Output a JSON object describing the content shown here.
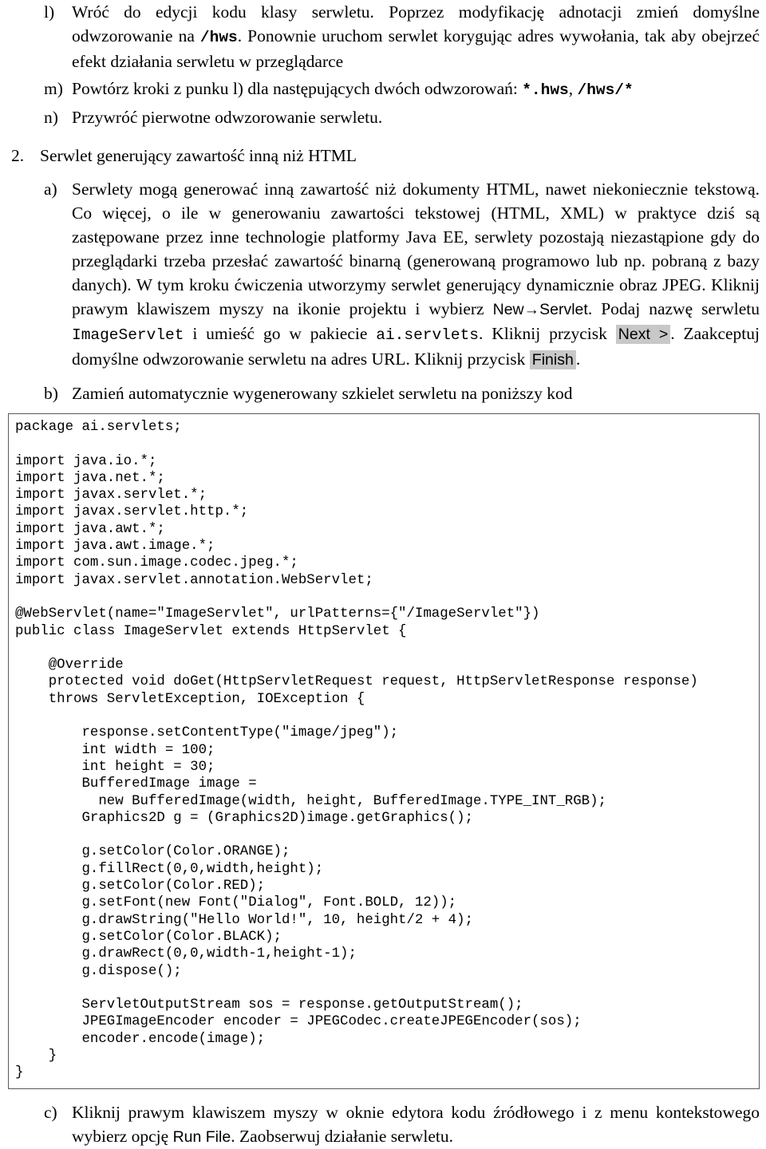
{
  "document": {
    "type": "exercise-handout",
    "language": "pl"
  },
  "items": [
    {
      "id": "l",
      "level": "alpha",
      "marker": "l)",
      "runs": [
        {
          "style": "normal",
          "text": "Wróć do edycji kodu klasy serwletu. Poprzez modyfikację adnotacji zmień domyślne odwzorowanie na "
        },
        {
          "style": "mono-bold",
          "text": "/hws"
        },
        {
          "style": "normal",
          "text": ". Ponownie uruchom serwlet korygując adres wywołania, tak aby obejrzeć efekt działania serwletu w przeglądarce"
        }
      ]
    },
    {
      "id": "m",
      "level": "alpha",
      "marker": "m)",
      "runs": [
        {
          "style": "normal",
          "text": "Powtórz kroki z punku l) dla następujących dwóch odwzorowań: "
        },
        {
          "style": "mono-bold",
          "text": "*.hws"
        },
        {
          "style": "normal",
          "text": ", "
        },
        {
          "style": "mono-bold",
          "text": "/hws/*"
        }
      ]
    },
    {
      "id": "n",
      "level": "alpha",
      "marker": "n)",
      "runs": [
        {
          "style": "normal",
          "text": "Przywróć pierwotne odwzorowanie serwletu."
        }
      ]
    },
    {
      "id": "2",
      "level": "num",
      "marker": "2.",
      "runs": [
        {
          "style": "normal",
          "text": "Serwlet generujący zawartość inną niż HTML"
        }
      ]
    },
    {
      "id": "2a",
      "level": "alpha",
      "marker": "a)",
      "runs": [
        {
          "style": "normal",
          "text": "Serwlety mogą generować inną zawartość niż dokumenty HTML, nawet niekoniecznie tekstową. Co więcej, o ile w generowaniu zawartości tekstowej (HTML, XML) w praktyce dziś są zastępowane przez inne technologie platformy Java EE, serwlety pozostają niezastąpione gdy do przeglądarki trzeba przesłać zawartość binarną (generowaną programowo lub np. pobraną z bazy danych). W tym kroku ćwiczenia utworzymy serwlet generujący dynamicznie obraz JPEG. Kliknij prawym klawiszem myszy na ikonie projektu i wybierz "
        },
        {
          "style": "ui",
          "text": "New→Servlet"
        },
        {
          "style": "normal",
          "text": ". Podaj nazwę serwletu "
        },
        {
          "style": "mono",
          "text": "ImageServlet"
        },
        {
          "style": "normal",
          "text": " i umieść go w pakiecie "
        },
        {
          "style": "mono",
          "text": "ai.servlets"
        },
        {
          "style": "normal",
          "text": ". Kliknij przycisk "
        },
        {
          "style": "ui-button",
          "text": "Next >"
        },
        {
          "style": "normal",
          "text": ". Zaakceptuj domyślne odwzorowanie serwletu na adres URL. Kliknij przycisk "
        },
        {
          "style": "ui-button",
          "text": "Finish"
        },
        {
          "style": "normal",
          "text": "."
        }
      ]
    },
    {
      "id": "2b",
      "level": "alpha",
      "marker": "b)",
      "justify": false,
      "runs": [
        {
          "style": "normal",
          "text": "Zamień automatycznie wygenerowany szkielet serwletu na poniższy kod"
        }
      ]
    }
  ],
  "code_block": {
    "language": "java",
    "border_color": "#595959",
    "text": "package ai.servlets;\n\nimport java.io.*;\nimport java.net.*;\nimport javax.servlet.*;\nimport javax.servlet.http.*;\nimport java.awt.*;\nimport java.awt.image.*;\nimport com.sun.image.codec.jpeg.*;\nimport javax.servlet.annotation.WebServlet;\n\n@WebServlet(name=\"ImageServlet\", urlPatterns={\"/ImageServlet\"})\npublic class ImageServlet extends HttpServlet {\n\n    @Override\n    protected void doGet(HttpServletRequest request, HttpServletResponse response)\n    throws ServletException, IOException {\n\n        response.setContentType(\"image/jpeg\");\n        int width = 100;\n        int height = 30;\n        BufferedImage image =\n          new BufferedImage(width, height, BufferedImage.TYPE_INT_RGB);\n        Graphics2D g = (Graphics2D)image.getGraphics();\n\n        g.setColor(Color.ORANGE);\n        g.fillRect(0,0,width,height);\n        g.setColor(Color.RED);\n        g.setFont(new Font(\"Dialog\", Font.BOLD, 12));\n        g.drawString(\"Hello World!\", 10, height/2 + 4);\n        g.setColor(Color.BLACK);\n        g.drawRect(0,0,width-1,height-1);\n        g.dispose();\n\n        ServletOutputStream sos = response.getOutputStream();\n        JPEGImageEncoder encoder = JPEGCodec.createJPEGEncoder(sos);\n        encoder.encode(image);\n    }\n}"
  },
  "items_after_code": [
    {
      "id": "2c",
      "level": "alpha",
      "marker": "c)",
      "runs": [
        {
          "style": "normal",
          "text": "Kliknij prawym klawiszem myszy w oknie edytora kodu źródłowego i z menu kontekstowego wybierz opcję "
        },
        {
          "style": "ui",
          "text": "Run File"
        },
        {
          "style": "normal",
          "text": ". Zaobserwuj działanie serwletu."
        }
      ]
    }
  ]
}
